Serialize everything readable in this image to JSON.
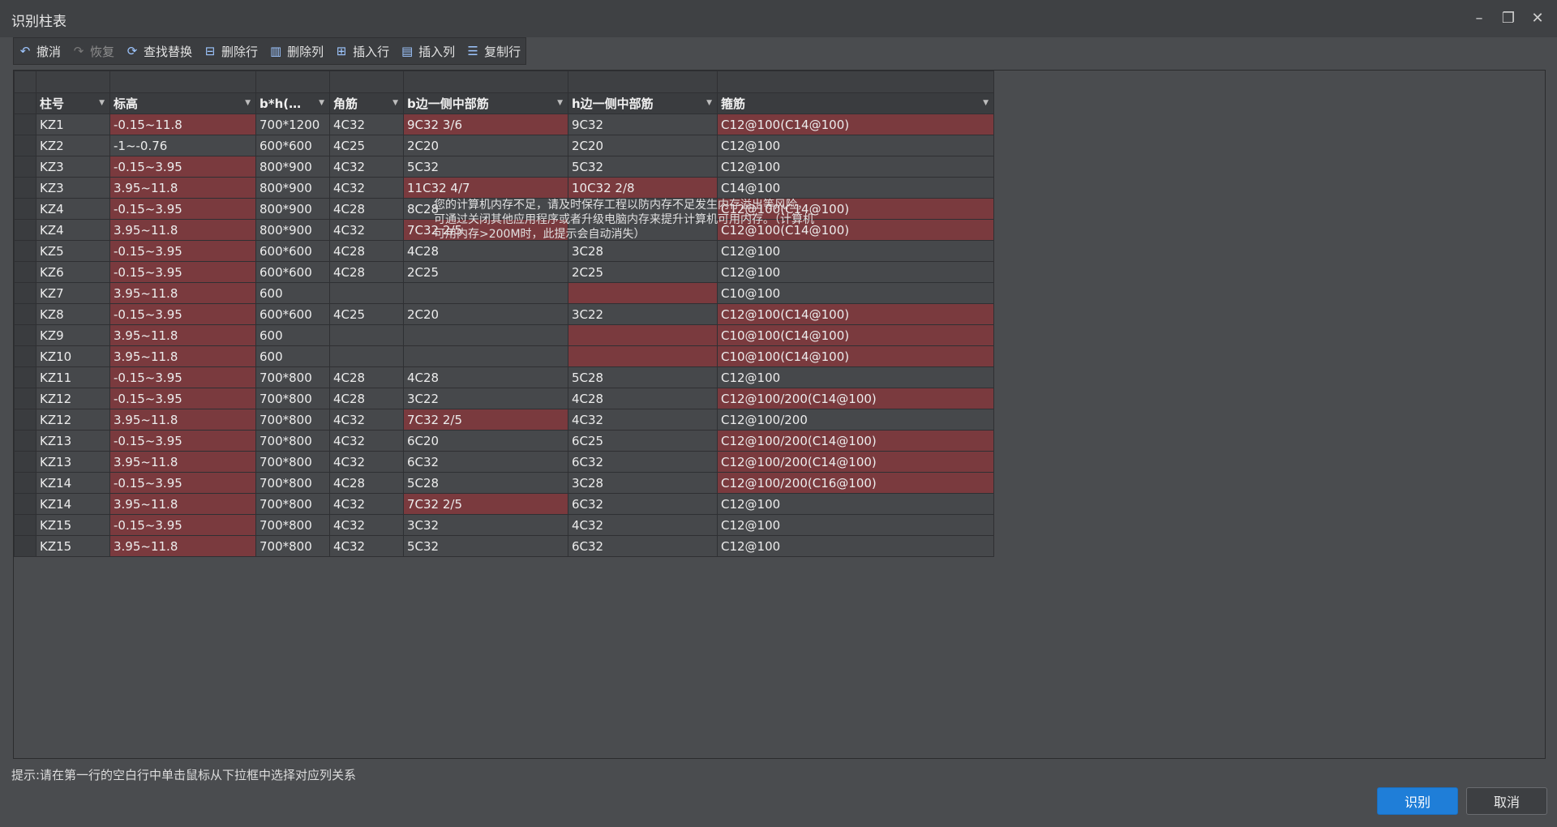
{
  "window": {
    "title": "识别柱表"
  },
  "toolbar": {
    "undo": "撤消",
    "redo": "恢复",
    "find_replace": "查找替换",
    "delete_row": "删除行",
    "delete_col": "删除列",
    "insert_row": "插入行",
    "insert_col": "插入列",
    "copy_row": "复制行"
  },
  "table": {
    "headers": [
      "柱号",
      "标高",
      "b*h(…",
      "角筋",
      "b边一侧中部筋",
      "h边一侧中部筋",
      "箍筋"
    ],
    "rows": [
      {
        "cells": [
          "KZ1",
          "-0.15~11.8",
          "700*1200",
          "4C32",
          "9C32 3/6",
          "9C32",
          "C12@100(C14@100)"
        ],
        "red": [
          1,
          4,
          6
        ]
      },
      {
        "cells": [
          "KZ2",
          "-1~-0.76",
          "600*600",
          "4C25",
          "2C20",
          "2C20",
          "C12@100"
        ],
        "red": []
      },
      {
        "cells": [
          "KZ3",
          "-0.15~3.95",
          "800*900",
          "4C32",
          "5C32",
          "5C32",
          "C12@100"
        ],
        "red": [
          1
        ]
      },
      {
        "cells": [
          "KZ3",
          "3.95~11.8",
          "800*900",
          "4C32",
          "11C32 4/7",
          "10C32 2/8",
          "C14@100"
        ],
        "red": [
          1,
          4,
          5
        ]
      },
      {
        "cells": [
          "KZ4",
          "-0.15~3.95",
          "800*900",
          "4C28",
          "8C28",
          "",
          "C12@100(C14@100)"
        ],
        "red": [
          1,
          6
        ]
      },
      {
        "cells": [
          "KZ4",
          "3.95~11.8",
          "800*900",
          "4C32",
          "7C32 2/5",
          "",
          "C12@100(C14@100)"
        ],
        "red": [
          1,
          4,
          6
        ]
      },
      {
        "cells": [
          "KZ5",
          "-0.15~3.95",
          "600*600",
          "4C28",
          "4C28",
          "3C28",
          "C12@100"
        ],
        "red": [
          1
        ]
      },
      {
        "cells": [
          "KZ6",
          "-0.15~3.95",
          "600*600",
          "4C28",
          "2C25",
          "2C25",
          "C12@100"
        ],
        "red": [
          1
        ]
      },
      {
        "cells": [
          "KZ7",
          "3.95~11.8",
          "600",
          "",
          "",
          "",
          "C10@100"
        ],
        "red": [
          1,
          5
        ]
      },
      {
        "cells": [
          "KZ8",
          "-0.15~3.95",
          "600*600",
          "4C25",
          "2C20",
          "3C22",
          "C12@100(C14@100)"
        ],
        "red": [
          1,
          6
        ]
      },
      {
        "cells": [
          "KZ9",
          "3.95~11.8",
          "600",
          "",
          "",
          "",
          "C10@100(C14@100)"
        ],
        "red": [
          1,
          5,
          6
        ]
      },
      {
        "cells": [
          "KZ10",
          "3.95~11.8",
          "600",
          "",
          "",
          "",
          "C10@100(C14@100)"
        ],
        "red": [
          1,
          5,
          6
        ]
      },
      {
        "cells": [
          "KZ11",
          "-0.15~3.95",
          "700*800",
          "4C28",
          "4C28",
          "5C28",
          "C12@100"
        ],
        "red": [
          1
        ]
      },
      {
        "cells": [
          "KZ12",
          "-0.15~3.95",
          "700*800",
          "4C28",
          "3C22",
          "4C28",
          "C12@100/200(C14@100)"
        ],
        "red": [
          1,
          6
        ]
      },
      {
        "cells": [
          "KZ12",
          "3.95~11.8",
          "700*800",
          "4C32",
          "7C32 2/5",
          "4C32",
          "C12@100/200"
        ],
        "red": [
          1,
          4
        ]
      },
      {
        "cells": [
          "KZ13",
          "-0.15~3.95",
          "700*800",
          "4C32",
          "6C20",
          "6C25",
          "C12@100/200(C14@100)"
        ],
        "red": [
          1,
          6
        ]
      },
      {
        "cells": [
          "KZ13",
          "3.95~11.8",
          "700*800",
          "4C32",
          "6C32",
          "6C32",
          "C12@100/200(C14@100)"
        ],
        "red": [
          1,
          6
        ]
      },
      {
        "cells": [
          "KZ14",
          "-0.15~3.95",
          "700*800",
          "4C28",
          "5C28",
          "3C28",
          "C12@100/200(C16@100)"
        ],
        "red": [
          1,
          6
        ]
      },
      {
        "cells": [
          "KZ14",
          "3.95~11.8",
          "700*800",
          "4C32",
          "7C32 2/5",
          "6C32",
          "C12@100"
        ],
        "red": [
          1,
          4
        ]
      },
      {
        "cells": [
          "KZ15",
          "-0.15~3.95",
          "700*800",
          "4C32",
          "3C32",
          "4C32",
          "C12@100"
        ],
        "red": [
          1
        ]
      },
      {
        "cells": [
          "KZ15",
          "3.95~11.8",
          "700*800",
          "4C32",
          "5C32",
          "6C32",
          "C12@100"
        ],
        "red": [
          1
        ]
      }
    ]
  },
  "overlay_message": "您的计算机内存不足，请及时保存工程以防内存不足发生内存溢出等风险，可通过关闭其他应用程序或者升级电脑内存来提升计算机可用内存。（计算机可用内存>200M时，此提示会自动消失）",
  "hint": "提示:请在第一行的空白行中单击鼠标从下拉框中选择对应列关系",
  "buttons": {
    "recognize": "识别",
    "cancel": "取消"
  },
  "colors": {
    "red_cell": "#7a3a3e",
    "primary": "#1f7ed8"
  }
}
